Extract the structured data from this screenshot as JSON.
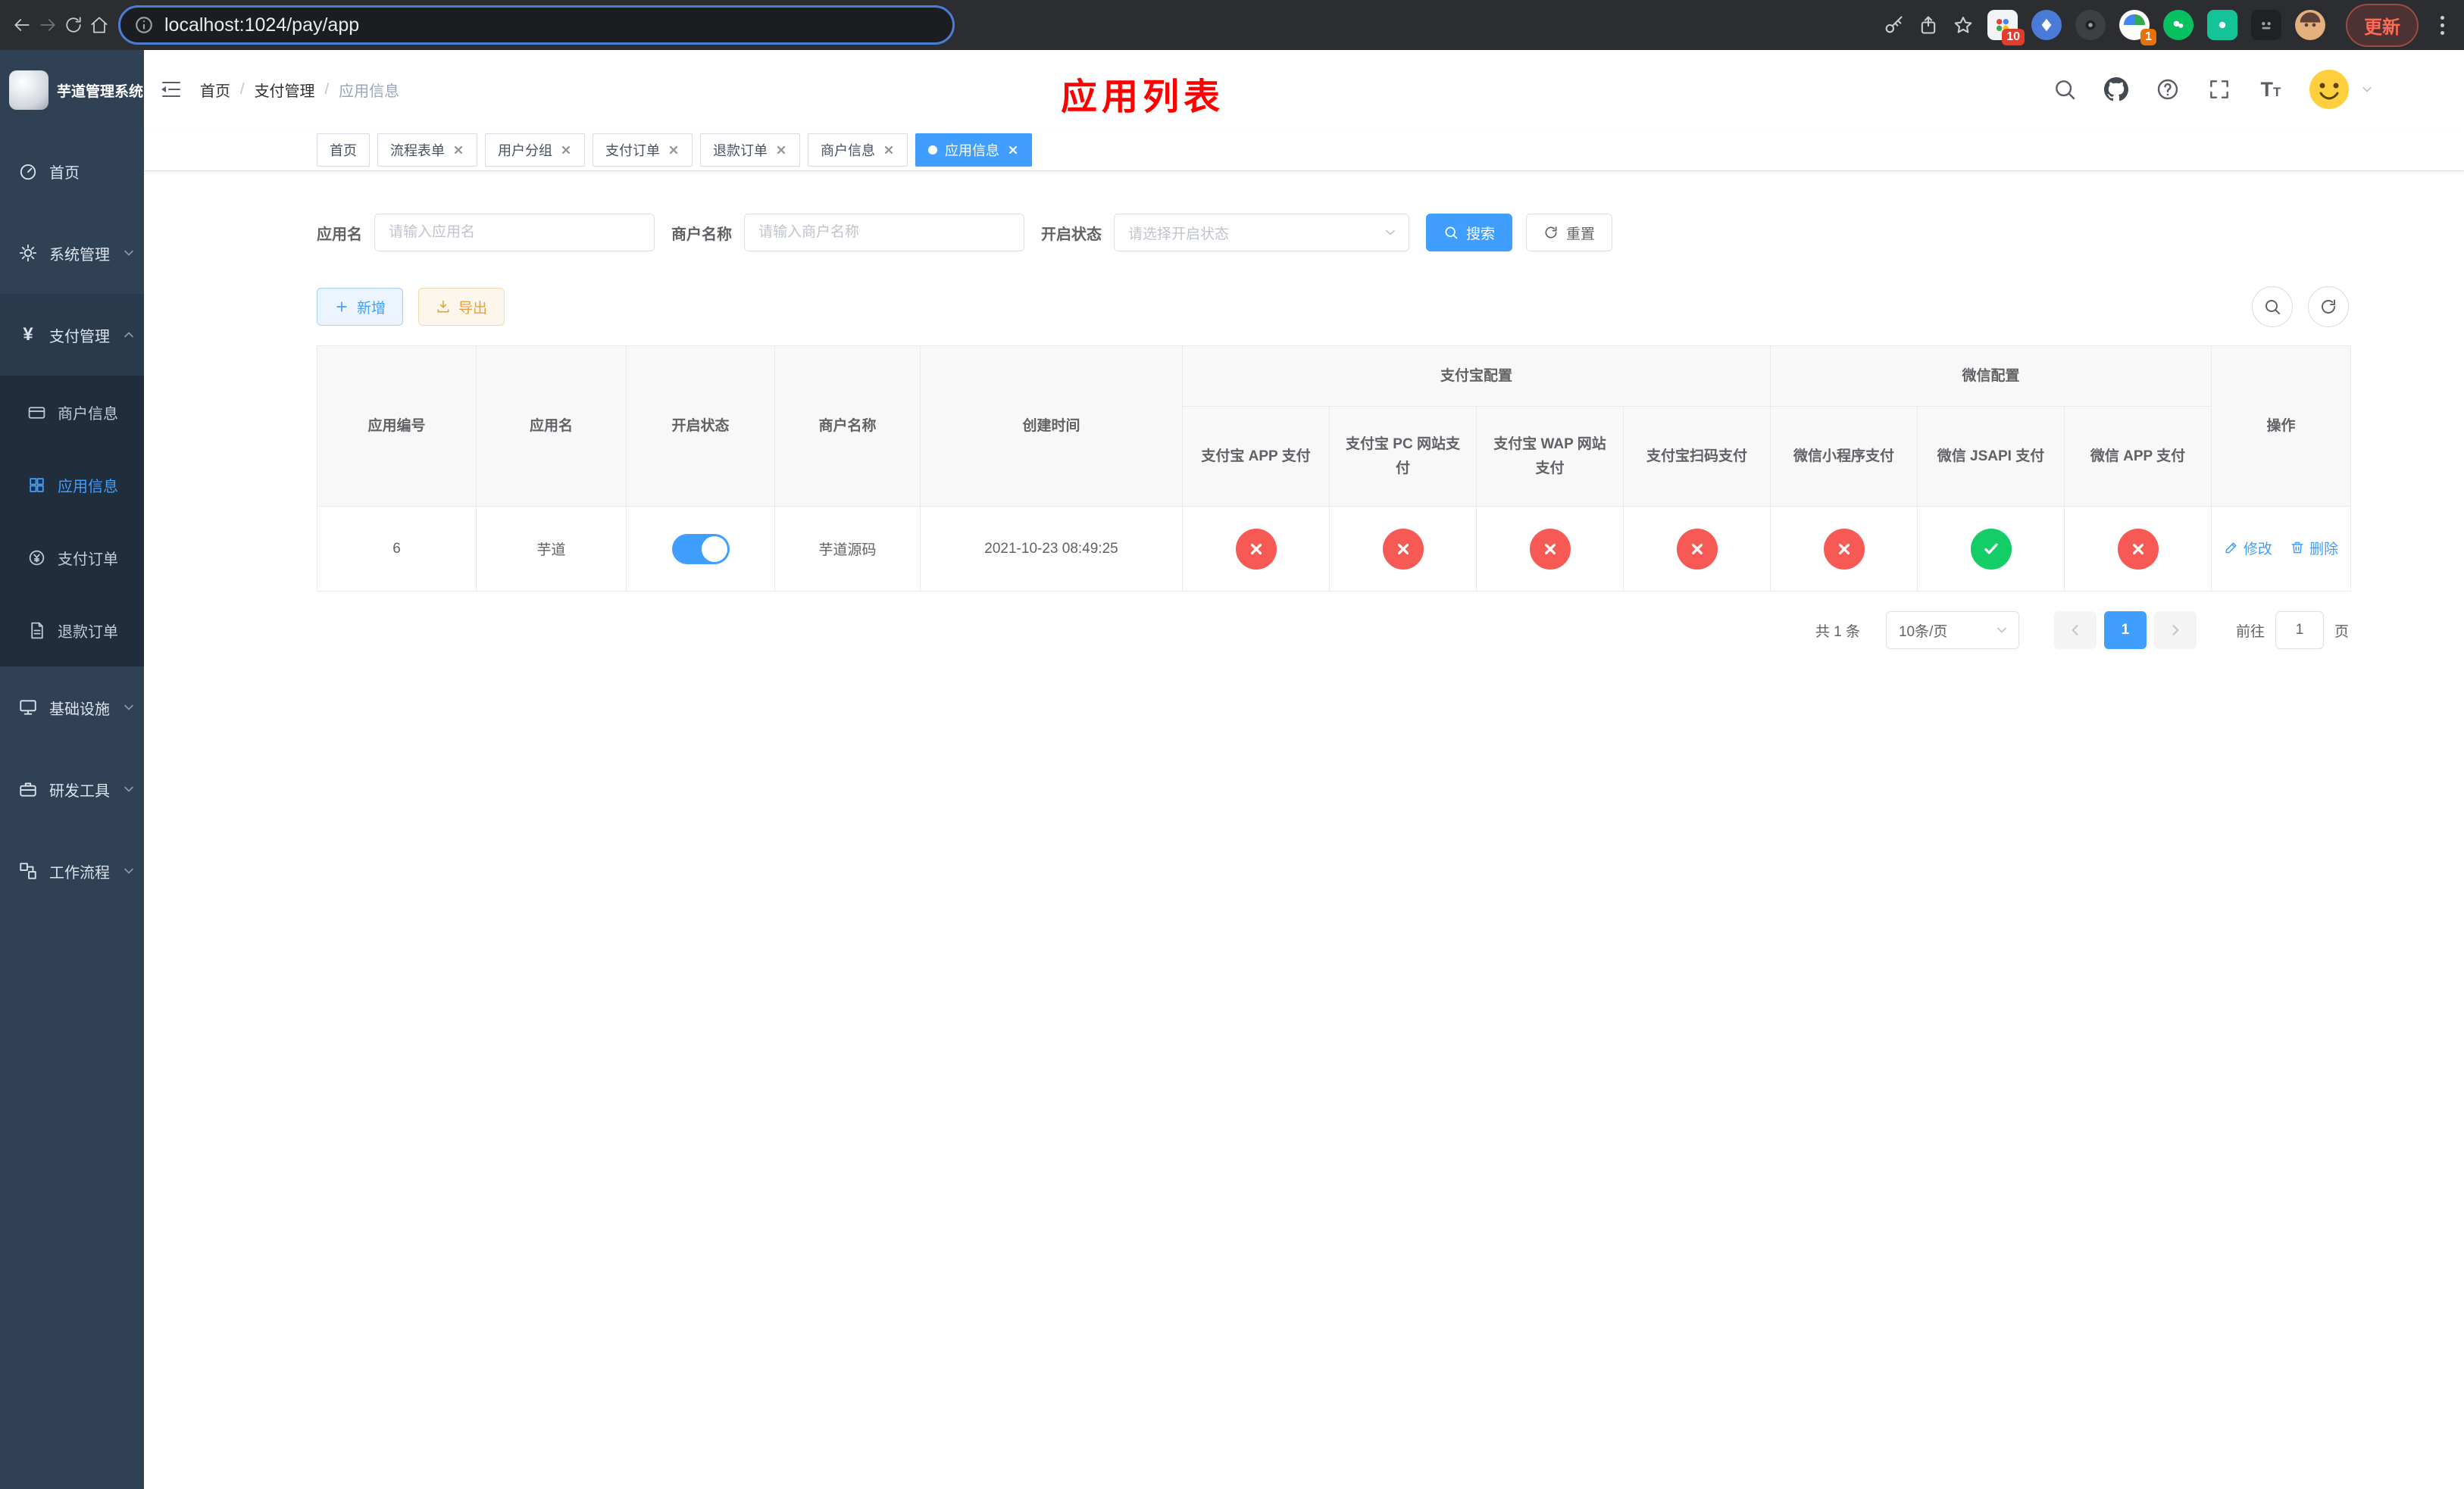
{
  "colors": {
    "accent": "#409eff",
    "success": "#13ce66",
    "danger": "#f56c6c",
    "annotation": "#ff0000",
    "sidebar_bg": "#304156",
    "sidebar_sub_bg": "#1f2d3d"
  },
  "browser": {
    "url": "localhost:1024/pay/app",
    "update_label": "更新",
    "ext_badge_1": "10",
    "ext_badge_2": "1"
  },
  "sidebar": {
    "logo_title": "芋道管理系统",
    "items": [
      {
        "label": "首页",
        "icon": "dashboard-icon"
      },
      {
        "label": "系统管理",
        "icon": "gear-icon",
        "chevron": "down"
      },
      {
        "label": "支付管理",
        "icon": "yen-icon",
        "chevron": "up",
        "expanded": true,
        "children": [
          {
            "label": "商户信息",
            "icon": "credit-card-icon"
          },
          {
            "label": "应用信息",
            "icon": "grid-icon",
            "active": true
          },
          {
            "label": "支付订单",
            "icon": "order-icon"
          },
          {
            "label": "退款订单",
            "icon": "document-icon"
          }
        ]
      },
      {
        "label": "基础设施",
        "icon": "monitor-icon",
        "chevron": "down"
      },
      {
        "label": "研发工具",
        "icon": "toolbox-icon",
        "chevron": "down"
      },
      {
        "label": "工作流程",
        "icon": "workflow-icon",
        "chevron": "down"
      }
    ]
  },
  "header": {
    "breadcrumb": [
      "首页",
      "支付管理",
      "应用信息"
    ],
    "annotation": "应用列表"
  },
  "tabs": [
    {
      "label": "首页",
      "active": false,
      "closable": false
    },
    {
      "label": "流程表单",
      "active": false,
      "closable": true
    },
    {
      "label": "用户分组",
      "active": false,
      "closable": true
    },
    {
      "label": "支付订单",
      "active": false,
      "closable": true
    },
    {
      "label": "退款订单",
      "active": false,
      "closable": true
    },
    {
      "label": "商户信息",
      "active": false,
      "closable": true
    },
    {
      "label": "应用信息",
      "active": true,
      "closable": true
    }
  ],
  "filters": {
    "app_name_label": "应用名",
    "app_name_placeholder": "请输入应用名",
    "merchant_label": "商户名称",
    "merchant_placeholder": "请输入商户名称",
    "status_label": "开启状态",
    "status_placeholder": "请选择开启状态",
    "search_label": "搜索",
    "reset_label": "重置"
  },
  "toolbar": {
    "add_label": "新增",
    "export_label": "导出"
  },
  "table": {
    "columns": [
      "应用编号",
      "应用名",
      "开启状态",
      "商户名称",
      "创建时间"
    ],
    "groups": [
      {
        "label": "支付宝配置",
        "children": [
          "支付宝 APP 支付",
          "支付宝 PC 网站支付",
          "支付宝 WAP 网站支付",
          "支付宝扫码支付"
        ]
      },
      {
        "label": "微信配置",
        "children": [
          "微信小程序支付",
          "微信 JSAPI 支付",
          "微信 APP 支付"
        ]
      }
    ],
    "action_column": "操作",
    "rows": [
      {
        "id": "6",
        "name": "芋道",
        "enabled": true,
        "merchant": "芋道源码",
        "created": "2021-10-23 08:49:25",
        "configs": [
          "no",
          "no",
          "no",
          "no",
          "no",
          "yes",
          "no"
        ],
        "edit_label": "修改",
        "delete_label": "删除"
      }
    ]
  },
  "pagination": {
    "total": "共 1 条",
    "page_size": "10条/页",
    "page": "1",
    "goto_label": "前往",
    "goto_value": "1",
    "unit_label": "页"
  }
}
